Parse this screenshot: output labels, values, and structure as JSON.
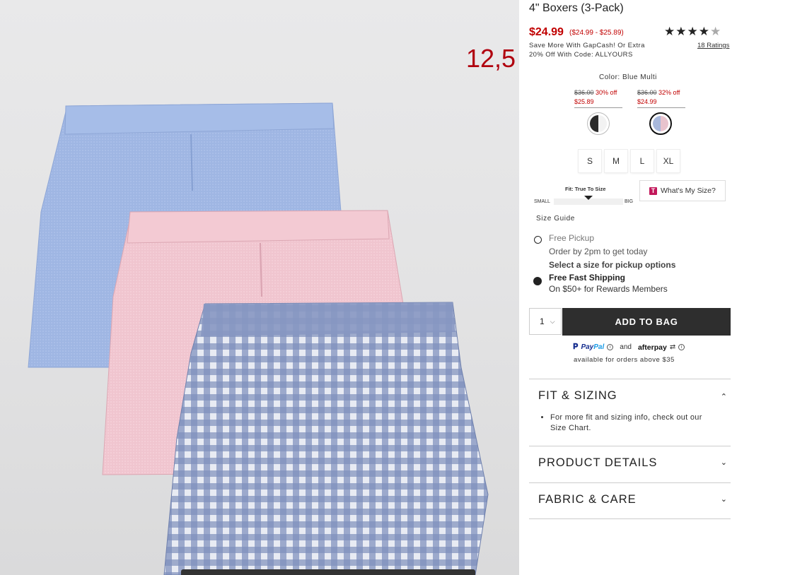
{
  "product": {
    "title": "4\" Boxers (3-Pack)",
    "price": "$24.99",
    "price_range": "($24.99 - $25.89)",
    "stars": "★★★★★",
    "rating_value": 4.5,
    "ratings_link": "18 Ratings",
    "promo_line1": "Save More With GapCash! Or Extra",
    "promo_line2": "20% Off With Code: ALLYOURS"
  },
  "overlay_number": "12,5",
  "color": {
    "label": "Color: Blue Multi",
    "swatches": [
      {
        "orig": "$36.00",
        "discount": "30% off",
        "sale": "$25.89",
        "selected": false,
        "colors": [
          "#2a2a2a",
          "#f2f2f2"
        ]
      },
      {
        "orig": "$36.00",
        "discount": "32% off",
        "sale": "$24.99",
        "selected": true,
        "colors": [
          "#a8b8dc",
          "#e8c3cd"
        ]
      }
    ]
  },
  "sizes": [
    "S",
    "M",
    "L",
    "XL"
  ],
  "fit": {
    "label": "Fit: True To Size",
    "small": "SMALL",
    "big": "BIG",
    "whats_my_size": "What's My Size?",
    "t_badge": "T"
  },
  "size_guide": "Size Guide",
  "fulfillment": {
    "pickup_title": "Free Pickup",
    "pickup_sub1": "Order by 2pm to get today",
    "pickup_sub2": "Select a size for pickup options",
    "shipping_title": "Free Fast Shipping",
    "shipping_sub": "On $50+ for Rewards Members"
  },
  "cart": {
    "qty": "1",
    "add_to_bag": "ADD TO BAG"
  },
  "payments": {
    "paypal_a": "Pay",
    "paypal_b": "Pal",
    "and": "and",
    "afterpay": "afterpay",
    "available": "available for orders above $35"
  },
  "accordion": {
    "fit_sizing": "FIT & SIZING",
    "fit_sizing_text": "For more fit and sizing info, check out our Size Chart.",
    "product_details": "PRODUCT DETAILS",
    "fabric_care": "FABRIC & CARE"
  },
  "colors": {
    "sale_red": "#c10000",
    "button_dark": "#2e2e2e",
    "overlay_red": "#b0000e"
  }
}
